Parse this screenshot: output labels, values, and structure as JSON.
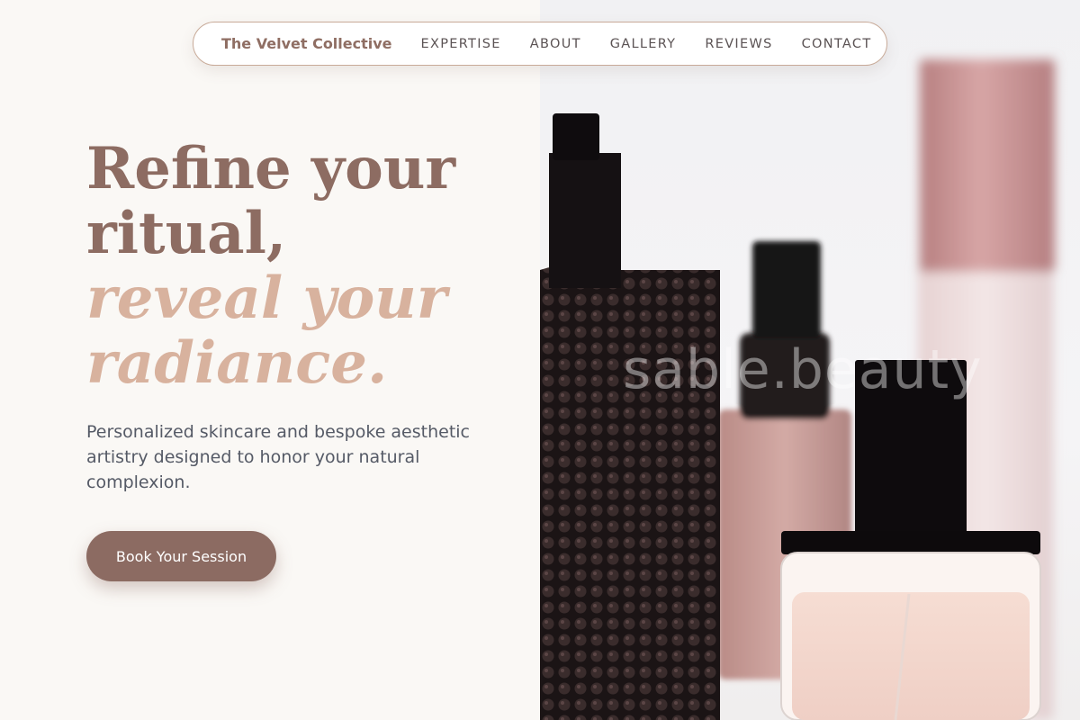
{
  "nav": {
    "brand": "The Velvet Collective",
    "links": [
      "EXPERTISE",
      "ABOUT",
      "GALLERY",
      "REVIEWS",
      "CONTACT"
    ]
  },
  "hero": {
    "headline_line1": "Refine your",
    "headline_line2": "ritual,",
    "headline_accent_line1": "reveal your",
    "headline_accent_line2": "radiance.",
    "subtext": "Personalized skincare and bespoke aesthetic artistry designed to honor your natural complexion.",
    "cta_label": "Book Your Session"
  },
  "image": {
    "watermark": "sable.beauty",
    "subject": "perfume bottles"
  },
  "colors": {
    "brand_brown": "#8c6b62",
    "accent_peach": "#d8b29e",
    "background": "#faf8f5",
    "body_text": "#555a66"
  }
}
